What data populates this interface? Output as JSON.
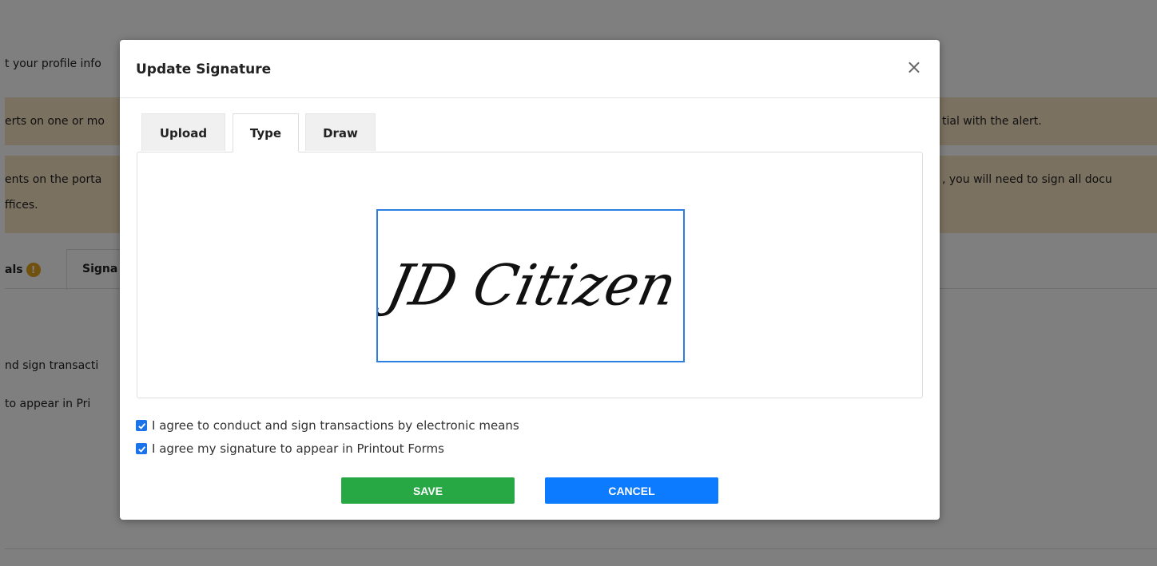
{
  "background": {
    "profile_text": "t your profile info",
    "alert1_text": "erts on one or mo",
    "alert1_right": "tial with the alert.",
    "alert2_line1": "ents on the porta",
    "alert2_line2": "ffices.",
    "alert2_right": ", you will need to sign all docu",
    "tab_partial": "als",
    "tab_signature_partial": "Signa",
    "line1": "nd sign transacti",
    "line2": " to appear in Pri",
    "badge": "!"
  },
  "modal": {
    "title": "Update Signature",
    "close_label": "×",
    "tabs": [
      {
        "label": "Upload",
        "active": false
      },
      {
        "label": "Type",
        "active": true
      },
      {
        "label": "Draw",
        "active": false
      }
    ],
    "signature_text": "JD Citizen",
    "agreements": [
      {
        "label": "I agree to conduct and sign transactions by electronic means",
        "checked": true
      },
      {
        "label": "I agree my signature to appear in Printout Forms",
        "checked": true
      }
    ],
    "save_label": "SAVE",
    "cancel_label": "CANCEL"
  },
  "colors": {
    "accent_blue": "#0d7bff",
    "save_green": "#28a745",
    "alert_bg": "#f6e2c3",
    "checkbox_blue": "#1a73e8"
  }
}
